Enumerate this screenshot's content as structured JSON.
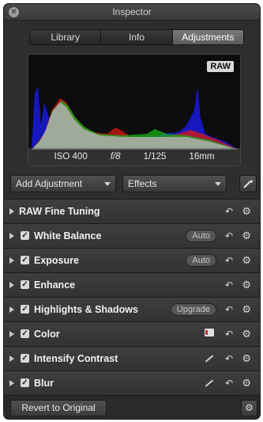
{
  "window": {
    "title": "Inspector"
  },
  "tabs": [
    {
      "label": "Library",
      "active": false
    },
    {
      "label": "Info",
      "active": false
    },
    {
      "label": "Adjustments",
      "active": true
    }
  ],
  "histogram": {
    "badge": "RAW",
    "exif": {
      "iso": "ISO 400",
      "aperture": "f/8",
      "shutter": "1/125",
      "focal": "16mm"
    }
  },
  "toolbar": {
    "add_adjustment": "Add Adjustment",
    "effects": "Effects",
    "wand_icon": "magic-wand-icon"
  },
  "rows": [
    {
      "label": "RAW Fine Tuning",
      "checked": false,
      "pill": "",
      "extra": ""
    },
    {
      "label": "White Balance",
      "checked": true,
      "pill": "Auto",
      "extra": ""
    },
    {
      "label": "Exposure",
      "checked": true,
      "pill": "Auto",
      "extra": ""
    },
    {
      "label": "Enhance",
      "checked": true,
      "pill": "",
      "extra": ""
    },
    {
      "label": "Highlights & Shadows",
      "checked": true,
      "pill": "Upgrade",
      "extra": ""
    },
    {
      "label": "Color",
      "checked": true,
      "pill": "",
      "extra": "list-icon"
    },
    {
      "label": "Intensify Contrast",
      "checked": true,
      "pill": "",
      "extra": "brush-icon"
    },
    {
      "label": "Blur",
      "checked": true,
      "pill": "",
      "extra": "brush-icon"
    }
  ],
  "footer": {
    "revert_label": "Revert to Original"
  },
  "colors": {
    "panel_bg": "#2e2e30",
    "active_tab": "#6a6a6c"
  }
}
